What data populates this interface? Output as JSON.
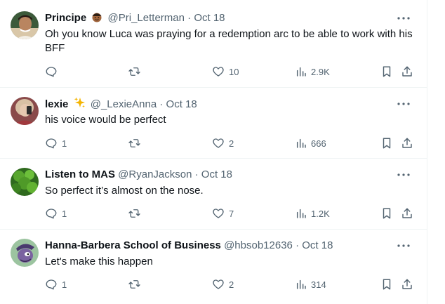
{
  "tweets": [
    {
      "name": "Principe",
      "handle": "@Pri_Letterman",
      "separator": "·",
      "date": "Oct 18",
      "text": "Oh you know Luca was praying for a redemption arc to be able to work with his BFF",
      "replies": "",
      "retweets": "",
      "likes": "10",
      "views": "2.9K",
      "badge": "emoji-face-icon"
    },
    {
      "name": "lexie",
      "handle": "@_LexieAnna",
      "separator": "·",
      "date": "Oct 18",
      "text": "his voice would be perfect",
      "replies": "1",
      "retweets": "",
      "likes": "2",
      "views": "666",
      "badge": "sparkles-icon"
    },
    {
      "name": "Listen to MAS",
      "handle": "@RyanJackson",
      "separator": "·",
      "date": "Oct 18",
      "text": "So perfect it’s almost on the nose.",
      "replies": "1",
      "retweets": "",
      "likes": "7",
      "views": "1.2K"
    },
    {
      "name": "Hanna-Barbera School of Business",
      "handle": "@hbsob12636",
      "separator": "·",
      "date": "Oct 18",
      "text": "Let's make this happen",
      "replies": "1",
      "retweets": "",
      "likes": "2",
      "views": "314"
    }
  ],
  "colors": {
    "text": "#0f1419",
    "secondary": "#536471",
    "divider": "#eff3f4",
    "background": "#ffffff"
  }
}
